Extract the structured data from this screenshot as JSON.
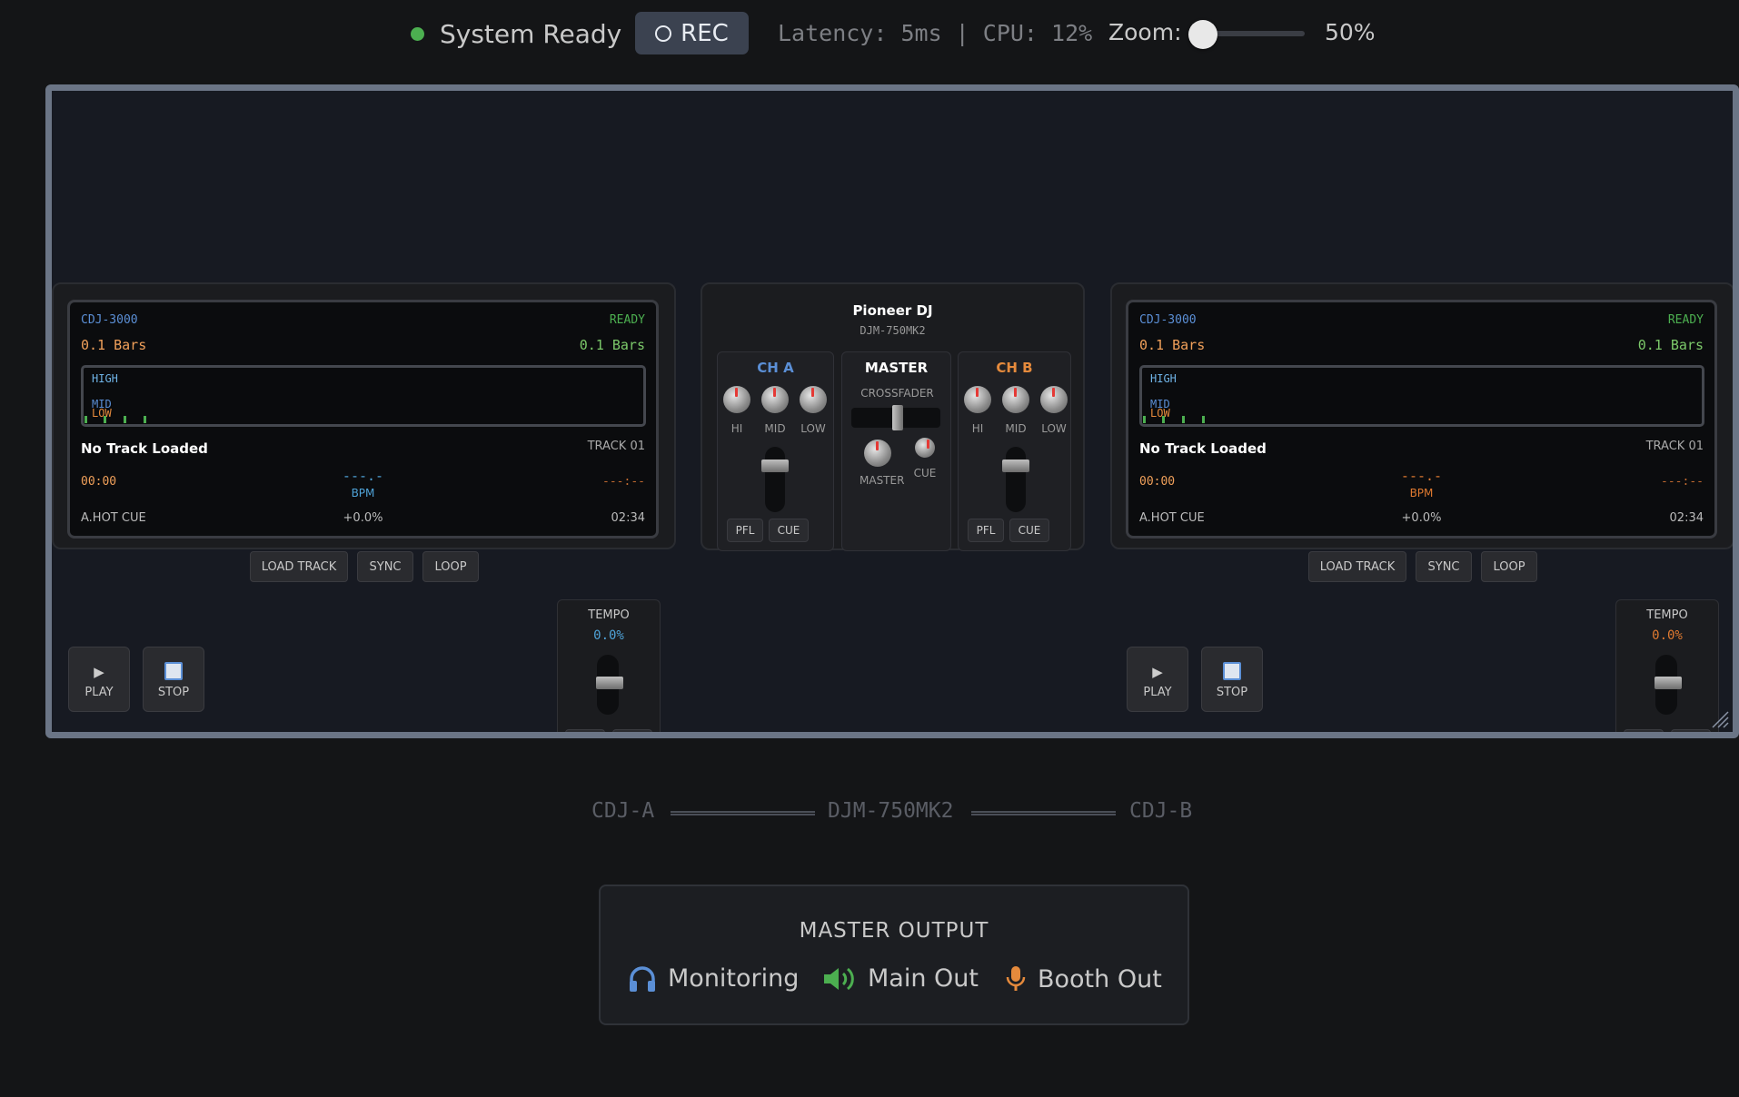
{
  "topbar": {
    "status_text": "System Ready",
    "rec_label": "REC",
    "latency_text": "Latency: 5ms | CPU: 12%",
    "zoom_label": "Zoom:",
    "zoom_value": "50%",
    "zoom_level": 0.5,
    "colors": {
      "status": "#4caf50",
      "rec_bg": "#3b4250"
    }
  },
  "deck_a": {
    "model": "CDJ-3000",
    "status": "READY",
    "bars_left": "0.1 Bars",
    "bars_right": "0.1 Bars",
    "wave_high": "HIGH",
    "wave_mid": "MID",
    "wave_low": "LOW",
    "track_name": "No Track Loaded",
    "track_num": "TRACK 01",
    "time_elapsed": "00:00",
    "bpm_value": "---.-",
    "bpm_label": "BPM",
    "time_remaining": "---:--",
    "hot_cue": "A.HOT CUE",
    "pitch": "+0.0%",
    "duration": "02:34",
    "load_label": "LOAD TRACK",
    "sync_label": "SYNC",
    "loop_label": "LOOP",
    "play_label": "PLAY",
    "stop_label": "STOP",
    "tempo_label": "TEMPO",
    "tempo_value": "0.0%",
    "accent": "#4fa3d8"
  },
  "deck_b": {
    "model": "CDJ-3000",
    "status": "READY",
    "bars_left": "0.1 Bars",
    "bars_right": "0.1 Bars",
    "wave_high": "HIGH",
    "wave_mid": "MID",
    "wave_low": "LOW",
    "track_name": "No Track Loaded",
    "track_num": "TRACK 01",
    "time_elapsed": "00:00",
    "bpm_value": "---.-",
    "bpm_label": "BPM",
    "time_remaining": "---:--",
    "hot_cue": "A.HOT CUE",
    "pitch": "+0.0%",
    "duration": "02:34",
    "load_label": "LOAD TRACK",
    "sync_label": "SYNC",
    "loop_label": "LOOP",
    "play_label": "PLAY",
    "stop_label": "STOP",
    "tempo_label": "TEMPO",
    "tempo_value": "0.0%",
    "accent": "#e07a30"
  },
  "mixer": {
    "brand": "Pioneer DJ",
    "model": "DJM-750MK2",
    "ch_a": {
      "title": "CH A",
      "hi": "HI",
      "mid": "MID",
      "low": "LOW",
      "pfl": "PFL",
      "cue": "CUE",
      "color": "#5b8fd6"
    },
    "master": {
      "title": "MASTER",
      "crossfader": "CROSSFADER",
      "master_label": "MASTER",
      "cue_label": "CUE"
    },
    "ch_b": {
      "title": "CH B",
      "hi": "HI",
      "mid": "MID",
      "low": "LOW",
      "pfl": "PFL",
      "cue": "CUE",
      "color": "#e58a3c"
    }
  },
  "chain": {
    "left": "CDJ-A",
    "center": "DJM-750MK2",
    "right": "CDJ-B"
  },
  "output": {
    "title": "MASTER OUTPUT",
    "items": [
      {
        "label": "Monitoring",
        "icon": "headphones-icon",
        "color": "#5b8fd6"
      },
      {
        "label": "Main Out",
        "icon": "speaker-icon",
        "color": "#4caf50"
      },
      {
        "label": "Booth Out",
        "icon": "microphone-icon",
        "color": "#e58a3c"
      }
    ]
  }
}
